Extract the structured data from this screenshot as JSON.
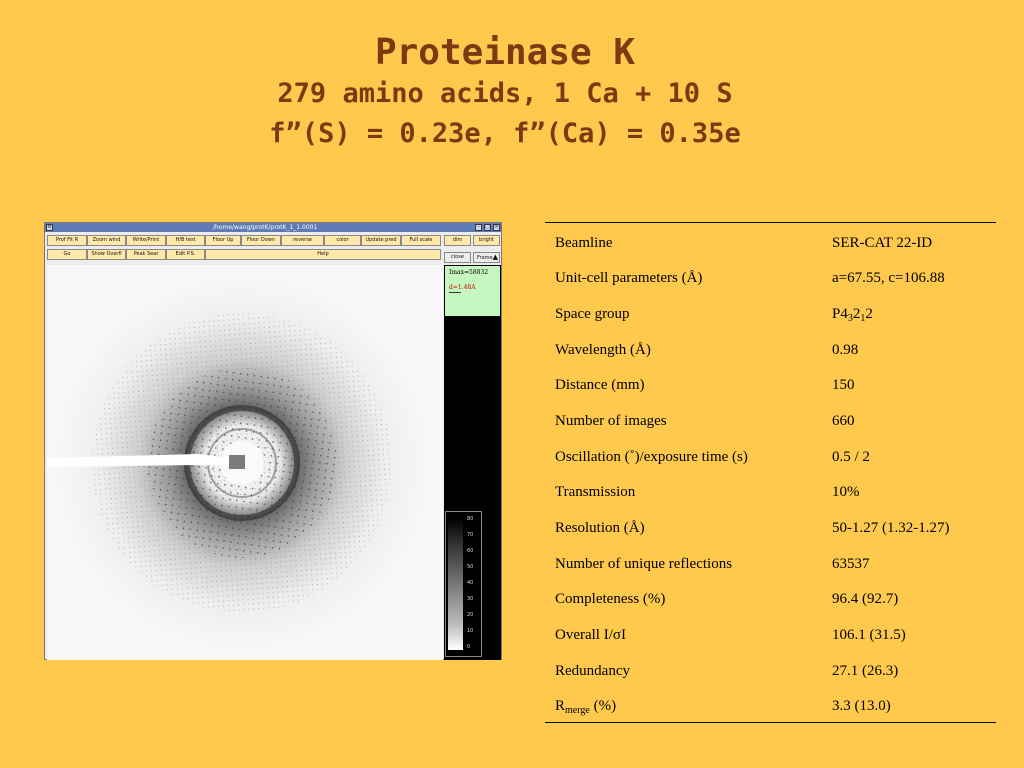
{
  "slide": {
    "title": "Proteinase K",
    "subtitle_line1": "279 amino acids, 1 Ca + 10 S",
    "subtitle_line2": "f”(S) = 0.23e, f”(Ca) = 0.35e"
  },
  "viewer": {
    "window_title": "/home/wang/protK/protK_1_1.0001",
    "toolbar_row1": [
      "Prof Fit R",
      "Zoom wind",
      "Write/Print",
      "H/B test",
      "Floor Up",
      "Floor Down",
      "reverse",
      "color",
      "Update pred",
      "Full scale"
    ],
    "toolbar_row2": [
      "Go",
      "Show Overfl",
      "Peak Sear",
      "Edit P.S."
    ],
    "help_label": "Help",
    "side_buttons": {
      "dim": "dim",
      "bright": "bright",
      "close": "close",
      "frame": "Frame"
    },
    "imax_label": "Imax=58832",
    "d_label": "d=1.48A",
    "scale_ticks": [
      "80",
      "70",
      "60",
      "50",
      "40",
      "30",
      "20",
      "10",
      "0"
    ]
  },
  "table": {
    "rows": [
      {
        "label": "Beamline",
        "value": "SER-CAT 22-ID"
      },
      {
        "label": "Unit-cell parameters (Å)",
        "value": "a=67.55, c=106.88"
      },
      {
        "label": "Space group",
        "value_base": "P4",
        "value_sub1": "3",
        "value_mid": "2",
        "value_sub2": "1",
        "value_end": "2"
      },
      {
        "label": "Wavelength (Å)",
        "value": "0.98"
      },
      {
        "label": "Distance (mm)",
        "value": "150"
      },
      {
        "label": "Number of images",
        "value": "660"
      },
      {
        "label": "Oscillation (˚)/exposure time (s)",
        "value": "0.5 / 2"
      },
      {
        "label": "Transmission",
        "value": "10%"
      },
      {
        "label": "Resolution (Å)",
        "value": "50-1.27 (1.32-1.27)"
      },
      {
        "label": "Number of unique reflections",
        "value": "63537"
      },
      {
        "label": "Completeness (%)",
        "value": "96.4 (92.7)"
      },
      {
        "label": "Overall I/σI",
        "value": "106.1 (31.5)"
      },
      {
        "label": "Redundancy",
        "value": "27.1 (26.3)"
      },
      {
        "label_base": "R",
        "label_sub": "merge",
        "label_end": " (%)",
        "value": "3.3 (13.0)"
      }
    ]
  }
}
